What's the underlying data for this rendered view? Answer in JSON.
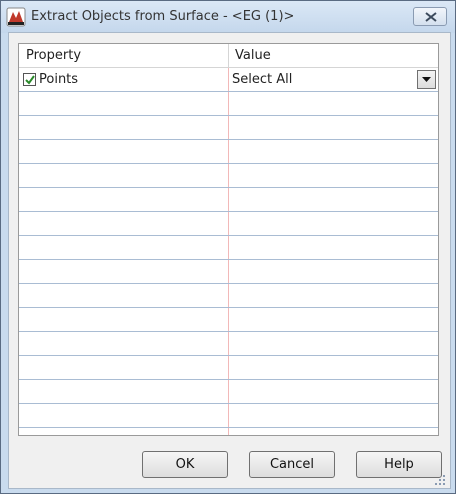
{
  "window": {
    "title": "Extract Objects from Surface - <EG (1)>"
  },
  "grid": {
    "columns": [
      "Property",
      "Value"
    ],
    "rows": [
      {
        "property": "Points",
        "checked": true,
        "value": "Select All"
      }
    ]
  },
  "buttons": {
    "ok": "OK",
    "cancel": "Cancel",
    "help": "Help"
  }
}
